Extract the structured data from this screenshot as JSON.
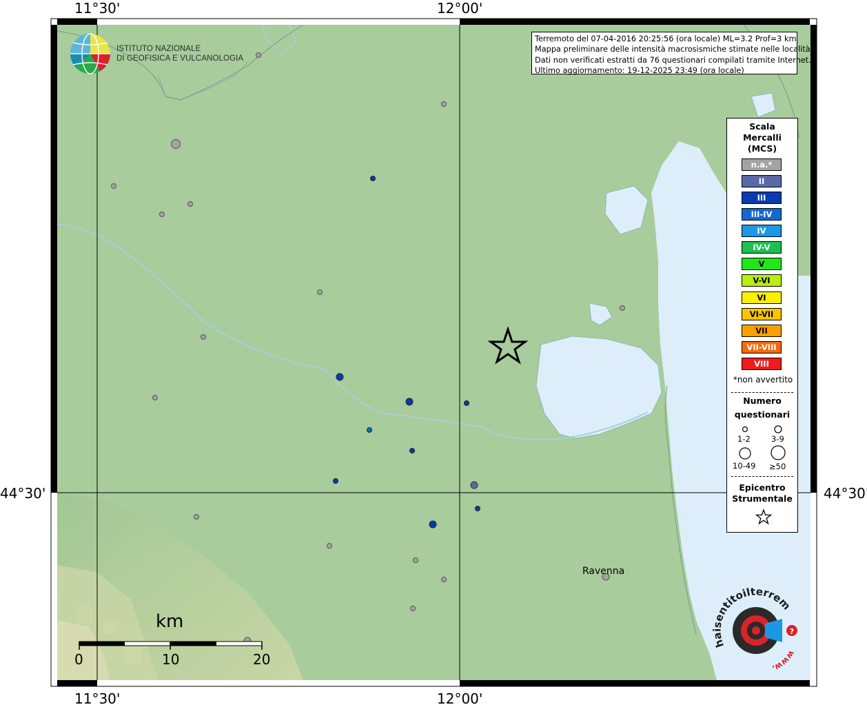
{
  "map": {
    "lon_labels": [
      "11°30'",
      "12°00'"
    ],
    "lat_labels": [
      "44°30'"
    ],
    "colors": {
      "plain": "#a8cc9b",
      "sea": "#ddeefa",
      "river": "#a9cfd6",
      "hills": "#c9d6a4",
      "grid": "#000000"
    }
  },
  "info": {
    "line1": "Terremoto del 07-04-2016 20:25:56 (ora locale) ML=3.2 Prof=3 km",
    "line2": "Mappa preliminare delle intensità macrosismiche stimate nelle località",
    "line3": "Dati non verificati estratti da 76 questionari compilati tramite Internet.",
    "line4": "Ultimo aggiornamento: 19-12-2025 23:49 (ora locale)"
  },
  "logo": {
    "line1": "ISTITUTO NAZIONALE",
    "line2": "DI GEOFISICA E VULCANOLOGIA"
  },
  "legend": {
    "title1": "Scala",
    "title2": "Mercalli",
    "title3": "(MCS)",
    "scale": [
      {
        "label": "n.a.*",
        "color": "#a3a3a3"
      },
      {
        "label": "II",
        "color": "#5a6aa8"
      },
      {
        "label": "III",
        "color": "#0a3ab0"
      },
      {
        "label": "III-IV",
        "color": "#1269d3"
      },
      {
        "label": "IV",
        "color": "#1b98e3"
      },
      {
        "label": "IV-V",
        "color": "#1fbf4f"
      },
      {
        "label": "V",
        "color": "#22e61c"
      },
      {
        "label": "V-VI",
        "color": "#b8ee10"
      },
      {
        "label": "VI",
        "color": "#f8f000"
      },
      {
        "label": "VI-VII",
        "color": "#f8c400"
      },
      {
        "label": "VII",
        "color": "#f8a000"
      },
      {
        "label": "VII-VIII",
        "color": "#f36a10"
      },
      {
        "label": "VIII",
        "color": "#ee1c1c"
      }
    ],
    "note": "*non avvertito",
    "num_title1": "Numero",
    "num_title2": "questionari",
    "sizes": [
      "1-2",
      "3-9",
      "10-49",
      "≥50"
    ],
    "epi_title1": "Epicentro",
    "epi_title2": "Strumentale"
  },
  "places": {
    "ravenna": "Ravenna"
  },
  "scale_bar": {
    "unit": "km",
    "ticks": [
      "0",
      "10",
      "20"
    ]
  },
  "watermark": {
    "text": "haisentitoilterremoto.it",
    "url": "www."
  }
}
